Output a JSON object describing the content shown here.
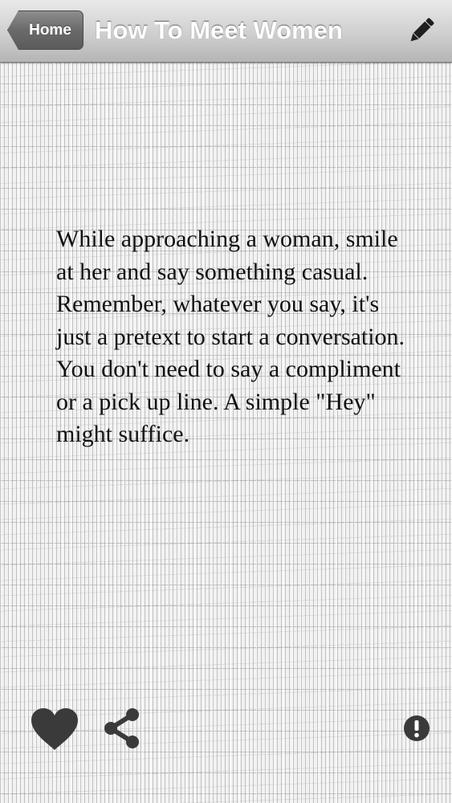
{
  "navbar": {
    "back_label": "Home",
    "title": "How To Meet Women",
    "edit_icon": "pencil-icon"
  },
  "content": {
    "text": "While approaching a woman, smile at her and say something casual. Remember, whatever you say, it's just a pretext to start a conversation. You don't need to say a compliment or a pick up line. A simple \"Hey\" might suffice."
  },
  "toolbar": {
    "favorite_icon": "heart-icon",
    "share_icon": "share-icon",
    "info_icon": "exclamation-icon"
  },
  "colors": {
    "icon": "#3a3a3a",
    "text": "#111111",
    "back_button": "#6a6a6a"
  }
}
